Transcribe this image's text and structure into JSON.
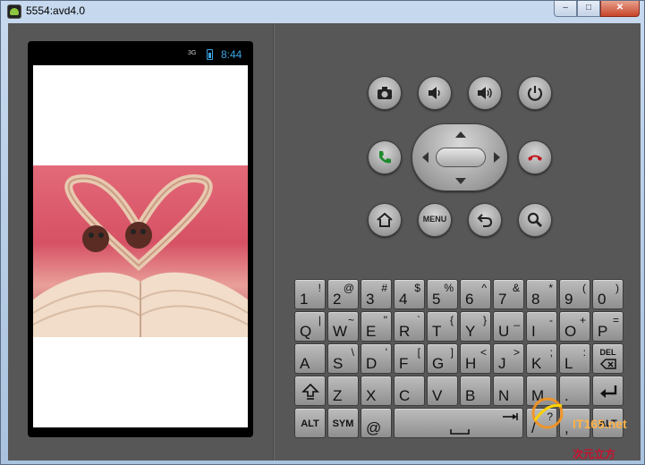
{
  "window": {
    "title": "5554:avd4.0",
    "min_glyph": "–",
    "max_glyph": "□",
    "close_glyph": "✕"
  },
  "status_bar": {
    "signal": "3G",
    "time": "8:44",
    "accent": "#3ba6e2"
  },
  "controls": {
    "menu_label": "MENU",
    "call_color": "#1f8a2e",
    "end_color": "#c0141c"
  },
  "keyboard": {
    "rows": [
      [
        {
          "main": "1",
          "alt": "!"
        },
        {
          "main": "2",
          "alt": "@"
        },
        {
          "main": "3",
          "alt": "#"
        },
        {
          "main": "4",
          "alt": "$"
        },
        {
          "main": "5",
          "alt": "%"
        },
        {
          "main": "6",
          "alt": "^"
        },
        {
          "main": "7",
          "alt": "&"
        },
        {
          "main": "8",
          "alt": "*"
        },
        {
          "main": "9",
          "alt": "("
        },
        {
          "main": "0",
          "alt": ")"
        }
      ],
      [
        {
          "main": "Q",
          "alt": "|"
        },
        {
          "main": "W",
          "alt": "~"
        },
        {
          "main": "E",
          "alt": "\""
        },
        {
          "main": "R",
          "alt": "`"
        },
        {
          "main": "T",
          "alt": "{"
        },
        {
          "main": "Y",
          "alt": "}"
        },
        {
          "main": "U",
          "alt": "_"
        },
        {
          "main": "I",
          "alt": "-"
        },
        {
          "main": "O",
          "alt": "+"
        },
        {
          "main": "P",
          "alt": "="
        }
      ],
      [
        {
          "main": "A",
          "alt": ""
        },
        {
          "main": "S",
          "alt": "\\"
        },
        {
          "main": "D",
          "alt": "'"
        },
        {
          "main": "F",
          "alt": "["
        },
        {
          "main": "G",
          "alt": "]"
        },
        {
          "main": "H",
          "alt": "<"
        },
        {
          "main": "J",
          "alt": ">"
        },
        {
          "main": "K",
          "alt": ";"
        },
        {
          "main": "L",
          "alt": ":"
        }
      ],
      [
        {
          "main": "Z",
          "alt": ""
        },
        {
          "main": "X",
          "alt": ""
        },
        {
          "main": "C",
          "alt": ""
        },
        {
          "main": "V",
          "alt": ""
        },
        {
          "main": "B",
          "alt": ""
        },
        {
          "main": "N",
          "alt": ""
        },
        {
          "main": "M",
          "alt": ""
        },
        {
          "main": ".",
          "alt": ""
        }
      ],
      [
        {
          "main": ",",
          "alt": ""
        },
        {
          "main": "/",
          "alt": "?"
        }
      ]
    ],
    "del_label": "DEL",
    "alt_label": "ALT",
    "sym_label": "SYM",
    "at_label": "@",
    "comma_label": ",",
    "slash_label": "/",
    "question_label": "?"
  },
  "watermark": {
    "brand": "IT165",
    "domain": ".net",
    "tagline": "次元立方"
  }
}
